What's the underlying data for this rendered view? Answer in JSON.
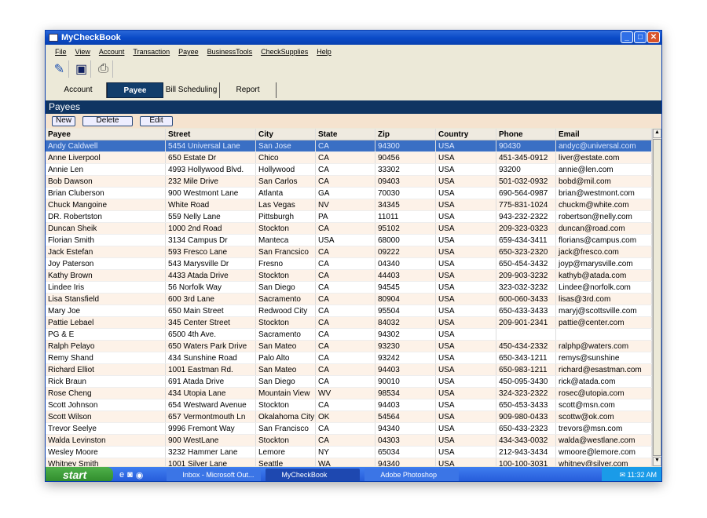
{
  "window": {
    "title": "MyCheckBook"
  },
  "menu": [
    "File",
    "View",
    "Account",
    "Transaction",
    "Payee",
    "BusinessTools",
    "CheckSupplies",
    "Help"
  ],
  "toolbar": {
    "icons": [
      "write-check-icon",
      "save-icon",
      "print-icon"
    ]
  },
  "tabs": [
    "Account",
    "Payee",
    "Bill Scheduling",
    "Report"
  ],
  "active_tab": "Payee",
  "panel": {
    "title": "Payees",
    "buttons": [
      "New",
      "Delete",
      "Edit"
    ]
  },
  "table": {
    "columns": [
      "Payee",
      "Street",
      "City",
      "State",
      "Zip",
      "Country",
      "Phone",
      "Email"
    ],
    "selected_row": 0,
    "rows": [
      [
        "Andy Caldwell",
        "5454 Universal Lane",
        "San Jose",
        "CA",
        "94300",
        "USA",
        "90430",
        "andyc@universal.com"
      ],
      [
        "Anne Liverpool",
        "650 Estate Dr",
        "Chico",
        "CA",
        "90456",
        "USA",
        "451-345-0912",
        "liver@estate.com"
      ],
      [
        "Annie Len",
        "4993 Hollywood Blvd.",
        "Hollywood",
        "CA",
        "33302",
        "USA",
        "93200",
        "annie@len.com"
      ],
      [
        "Bob Dawson",
        "232 Mile Drive",
        "San Carlos",
        "CA",
        "09403",
        "USA",
        "501-032-0932",
        "bobd@mil.com"
      ],
      [
        "Brian Cluberson",
        "900 Westmont Lane",
        "Atlanta",
        "GA",
        "70030",
        "USA",
        "690-564-0987",
        "brian@westmont.com"
      ],
      [
        "Chuck Mangoine",
        "White Road",
        "Las Vegas",
        "NV",
        "34345",
        "USA",
        "775-831-1024",
        "chuckm@white.com"
      ],
      [
        "DR. Robertston",
        "559  Nelly Lane",
        "Pittsburgh",
        "PA",
        "11011",
        "USA",
        "943-232-2322",
        "robertson@nelly.com"
      ],
      [
        "Duncan Sheik",
        "1000 2nd Road",
        "Stockton",
        "CA",
        "95102",
        "USA",
        "209-323-0323",
        "duncan@road.com"
      ],
      [
        "Florian Smith",
        "3134 Campus Dr",
        "Manteca",
        "USA",
        "68000",
        "USA",
        "659-434-3411",
        "florians@campus.com"
      ],
      [
        "Jack Estefan",
        "593 Fresco Lane",
        "San Francsico",
        "CA",
        "09222",
        "USA",
        "650-323-2320",
        "jack@fresco.com"
      ],
      [
        "Joy Paterson",
        "543 Marysville Dr",
        "Fresno",
        "CA",
        "04340",
        "USA",
        "650-454-3432",
        "joyp@marysville.com"
      ],
      [
        "Kathy Brown",
        "4433 Atada Drive",
        "Stockton",
        "CA",
        "44403",
        "USA",
        "209-903-3232",
        "kathyb@atada.com"
      ],
      [
        "Lindee Iris",
        "56 Norfolk Way",
        "San Diego",
        "CA",
        "94545",
        "USA",
        "323-032-3232",
        "Lindee@norfolk.com"
      ],
      [
        "Lisa Stansfield",
        "600 3rd Lane",
        "Sacramento",
        "CA",
        "80904",
        "USA",
        "600-060-3433",
        "lisas@3rd.com"
      ],
      [
        "Mary Joe",
        "650 Main Street",
        "Redwood City",
        "CA",
        "95504",
        "USA",
        "650-433-3433",
        "maryj@scottsville.com"
      ],
      [
        "Pattie Lebael",
        "345 Center Street",
        "Stockton",
        "CA",
        "84032",
        "USA",
        "209-901-2341",
        "pattie@center.com"
      ],
      [
        "PG & E",
        "6500 4th Ave.",
        "Sacramento",
        "CA",
        "94302",
        "USA",
        "",
        ""
      ],
      [
        "Ralph Pelayo",
        "650 Waters Park Drive",
        "San Mateo",
        "CA",
        "93230",
        "USA",
        "450-434-2332",
        "ralphp@waters.com"
      ],
      [
        "Remy Shand",
        "434 Sunshine Road",
        "Palo Alto",
        "CA",
        "93242",
        "USA",
        "650-343-1211",
        "remys@sunshine"
      ],
      [
        "Richard Elliot",
        "1001 Eastman Rd.",
        "San Mateo",
        "CA",
        "94403",
        "USA",
        "650-983-1211",
        "richard@esastman.com"
      ],
      [
        "Rick Braun",
        "691 Atada Drive",
        "San Diego",
        "CA",
        "90010",
        "USA",
        "450-095-3430",
        "rick@atada.com"
      ],
      [
        "Rose Cheng",
        "434 Utopia Lane",
        "Mountain View",
        "WV",
        "98534",
        "USA",
        "324-323-2322",
        "rosec@utopia.com"
      ],
      [
        "Scott Johnson",
        "654 Westward Avenue",
        "Stockton",
        "CA",
        "94403",
        "USA",
        "650-453-3433",
        "scott@msn.com"
      ],
      [
        "Scott Wilson",
        "657 Vermontmouth Ln",
        "Okalahoma City",
        "OK",
        "54564",
        "USA",
        "909-980-0433",
        "scottw@ok.com"
      ],
      [
        "Trevor Seelye",
        "9996 Fremont Way",
        "San Francisco",
        "CA",
        "94340",
        "USA",
        "650-433-2323",
        "trevors@msn.com"
      ],
      [
        "Walda Levinston",
        "900 WestLane",
        "Stockton",
        "CA",
        "04303",
        "USA",
        "434-343-0032",
        "walda@westlane.com"
      ],
      [
        "Wesley Moore",
        "3232 Hammer Lane",
        "Lemore",
        "NY",
        "65034",
        "USA",
        "212-943-3434",
        "wmoore@lemore.com"
      ],
      [
        "Whitney Smith",
        "1001 Silver Lane",
        "Seattle",
        "WA",
        "94340",
        "USA",
        "100-100-3031",
        "whitney@silver.com"
      ]
    ]
  },
  "taskbar": {
    "start": "start",
    "tasks": [
      "Inbox - Microsoft Out...",
      "MyCheckBook",
      "Adobe Photoshop"
    ],
    "active_task": "MyCheckBook",
    "clock": "11:32 AM"
  }
}
